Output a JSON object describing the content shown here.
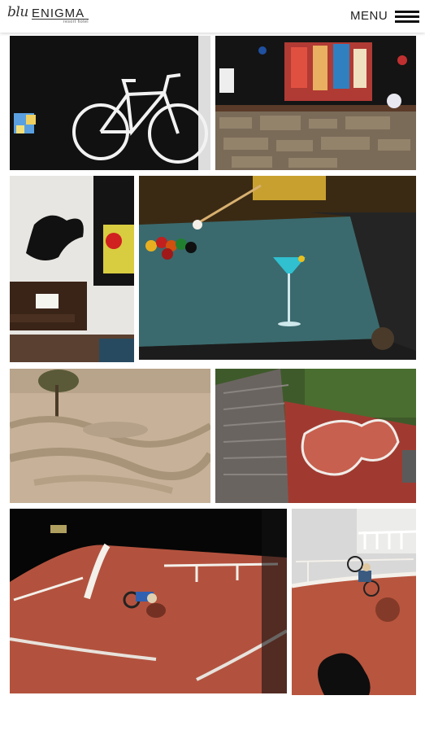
{
  "header": {
    "logo_script": "blu",
    "logo_main": "ENIGMA",
    "logo_sub": "resort hotel",
    "menu_label": "MENU"
  },
  "gallery": {
    "photos": [
      {
        "icon": "bicycle-wall-art"
      },
      {
        "icon": "painting-over-stone-wall"
      },
      {
        "icon": "piano-lounge-artwork"
      },
      {
        "icon": "pool-table-cocktail"
      },
      {
        "icon": "bmx-dirt-track"
      },
      {
        "icon": "skate-bowl-aerial"
      },
      {
        "icon": "bmx-rider-night-bowl"
      },
      {
        "icon": "bmx-rider-bowl-edge"
      }
    ]
  }
}
